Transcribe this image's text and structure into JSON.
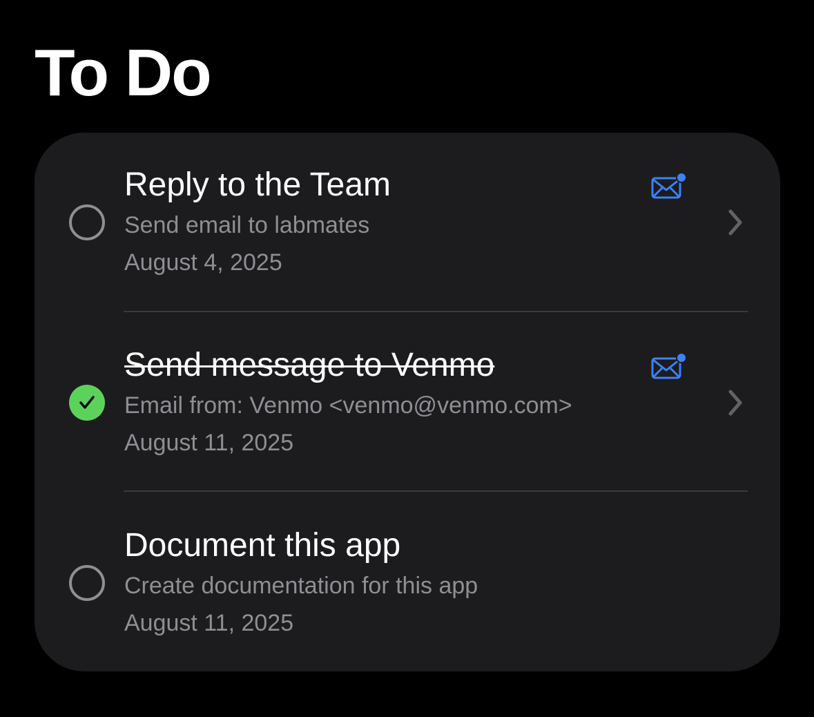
{
  "header": {
    "title": "To Do"
  },
  "colors": {
    "background": "#000000",
    "card": "#1c1c1e",
    "accent_blue": "#3b82f6",
    "done_green": "#5bd35b",
    "secondary_text": "#8e8e93"
  },
  "todos": [
    {
      "title": "Reply to the Team",
      "subtitle": "Send email to labmates",
      "date": "August 4, 2025",
      "completed": false,
      "icon": "mail-unread-icon"
    },
    {
      "title": "Send message to Venmo",
      "subtitle": "Email from: Venmo <venmo@venmo.com>",
      "date": "August 11, 2025",
      "completed": true,
      "icon": "mail-unread-icon"
    },
    {
      "title": "Document this app",
      "subtitle": "Create documentation for this app",
      "date": "August 11, 2025",
      "completed": false
    }
  ]
}
